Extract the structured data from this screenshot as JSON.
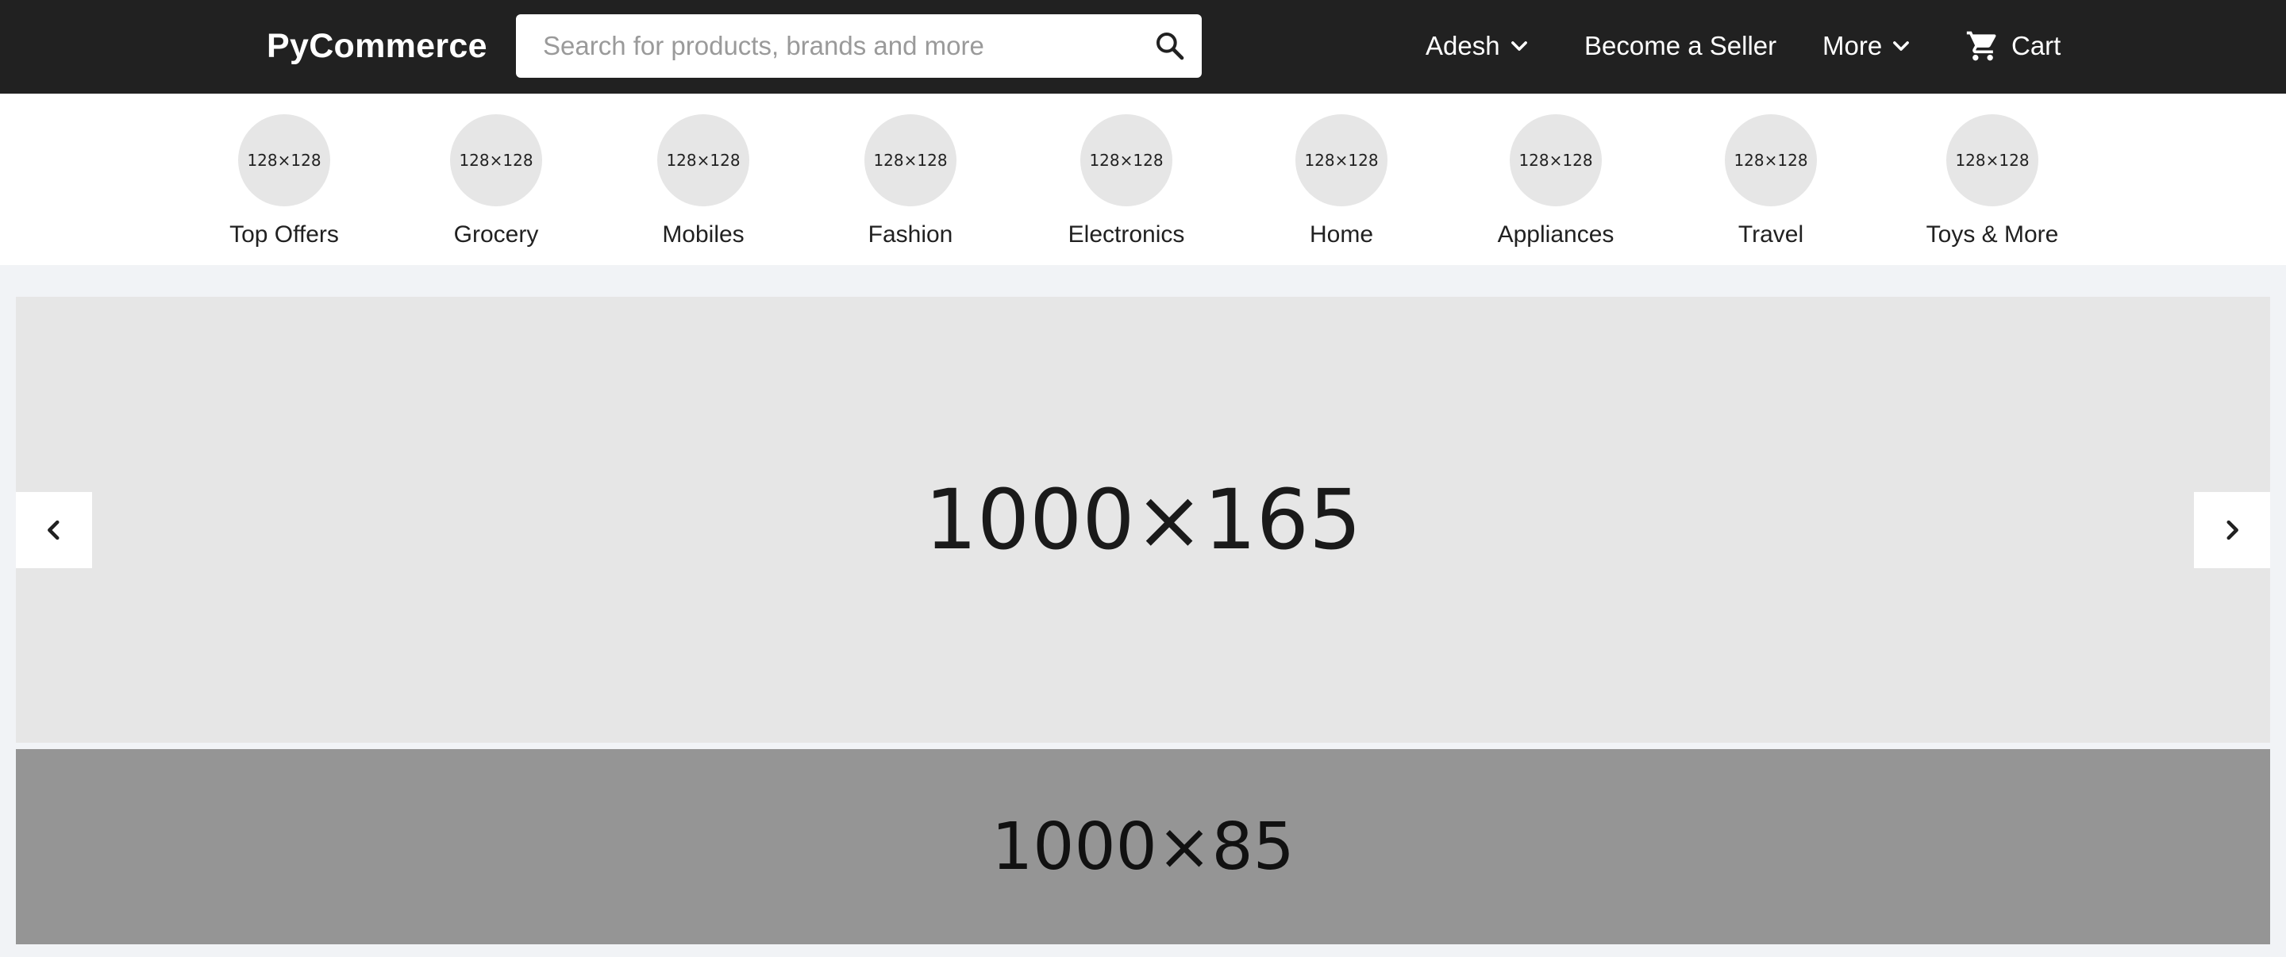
{
  "header": {
    "logo": "PyCommerce",
    "search_placeholder": "Search for products, brands and more",
    "user_label": "Adesh",
    "seller_label": "Become a Seller",
    "more_label": "More",
    "cart_label": "Cart",
    "background_color": "#212121"
  },
  "categories": [
    {
      "label": "Top Offers",
      "image_text": "128×128"
    },
    {
      "label": "Grocery",
      "image_text": "128×128"
    },
    {
      "label": "Mobiles",
      "image_text": "128×128"
    },
    {
      "label": "Fashion",
      "image_text": "128×128"
    },
    {
      "label": "Electronics",
      "image_text": "128×128"
    },
    {
      "label": "Home",
      "image_text": "128×128"
    },
    {
      "label": "Appliances",
      "image_text": "128×128"
    },
    {
      "label": "Travel",
      "image_text": "128×128"
    },
    {
      "label": "Toys & More",
      "image_text": "128×128"
    }
  ],
  "carousel": {
    "image_text": "1000×165",
    "prev_icon": "chevron-left-icon",
    "next_icon": "chevron-right-icon"
  },
  "banner": {
    "image_text": "1000×85"
  }
}
